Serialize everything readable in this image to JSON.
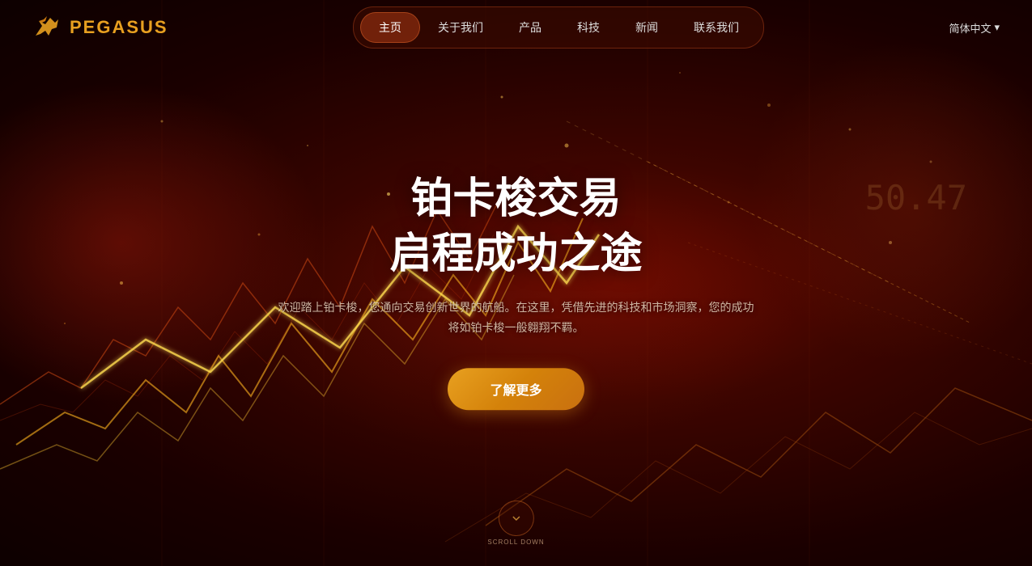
{
  "brand": {
    "name": "PEGASUS",
    "logo_alt": "Pegasus Logo"
  },
  "navbar": {
    "items": [
      {
        "label": "主页",
        "active": true
      },
      {
        "label": "关于我们",
        "active": false
      },
      {
        "label": "产品",
        "active": false
      },
      {
        "label": "科技",
        "active": false
      },
      {
        "label": "新闻",
        "active": false
      },
      {
        "label": "联系我们",
        "active": false
      }
    ],
    "lang_label": "简体中文",
    "lang_arrow": "▾"
  },
  "hero": {
    "title_line1": "铂卡梭交易",
    "title_line2": "启程成功之途",
    "subtitle": "欢迎踏上铂卡梭，您通向交易创新世界的航船。在这里，凭借先进的科技和市场洞察，您的成功将如铂卡梭一般翱翔不羁。",
    "cta_label": "了解更多"
  },
  "scroll": {
    "text": "SCROLL DOWN"
  },
  "chart_number": "50.47"
}
